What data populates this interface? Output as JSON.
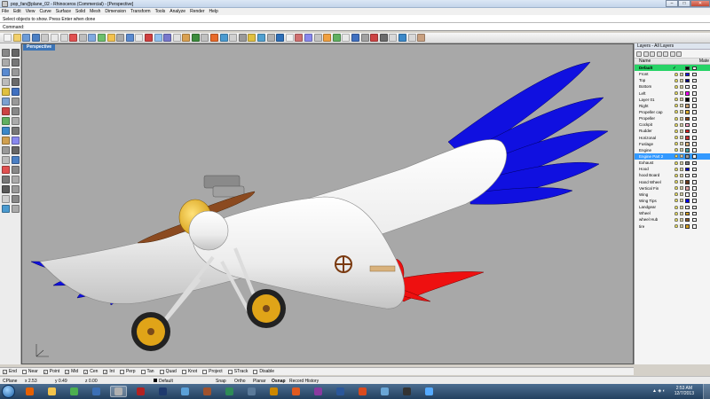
{
  "window": {
    "title": "pop_fan@plane_02 - Rhinoceros (Commercial) - [Perspective]",
    "min_label": "–",
    "max_label": "□",
    "close_label": "✕"
  },
  "menu": [
    "File",
    "Edit",
    "View",
    "Curve",
    "Surface",
    "Solid",
    "Mesh",
    "Dimension",
    "Transform",
    "Tools",
    "Analyze",
    "Render",
    "Help"
  ],
  "command": {
    "history": "Select objects to show. Press Enter when done",
    "label": "Command:",
    "value": ""
  },
  "viewport": {
    "name": "Perspective",
    "axis_x": "x",
    "axis_y": "y",
    "axis_z": "z"
  },
  "layers_panel": {
    "title": "Layers - All Layers",
    "col_name": "Name",
    "col_material": "Mate",
    "layers": [
      {
        "name": "Default",
        "color": "#000000",
        "current": true,
        "selected": false
      },
      {
        "name": "Front",
        "color": "#1a1aff",
        "current": false,
        "selected": false
      },
      {
        "name": "Top",
        "color": "#000080",
        "current": false,
        "selected": false
      },
      {
        "name": "Bottom",
        "color": "#ffffff",
        "current": false,
        "selected": false
      },
      {
        "name": "Left",
        "color": "#ff00ff",
        "current": false,
        "selected": false
      },
      {
        "name": "Layer 01",
        "color": "#000000",
        "current": false,
        "selected": false
      },
      {
        "name": "Right",
        "color": "#c8a070",
        "current": false,
        "selected": false
      },
      {
        "name": "Propeller cap",
        "color": "#e0b030",
        "current": false,
        "selected": false
      },
      {
        "name": "Propeller",
        "color": "#8b4513",
        "current": false,
        "selected": false
      },
      {
        "name": "Cockpit",
        "color": "#ffaacc",
        "current": false,
        "selected": false
      },
      {
        "name": "Rudder",
        "color": "#dd2222",
        "current": false,
        "selected": false
      },
      {
        "name": "Horizonal",
        "color": "#cc3333",
        "current": false,
        "selected": false
      },
      {
        "name": "Fuslage",
        "color": "#d9b27c",
        "current": false,
        "selected": false
      },
      {
        "name": "Engine",
        "color": "#40a0a0",
        "current": false,
        "selected": false
      },
      {
        "name": "Engine Part 2",
        "color": "#9a9a9a",
        "current": false,
        "selected": true
      },
      {
        "name": "Exhaust",
        "color": "#7f7f7f",
        "current": false,
        "selected": false
      },
      {
        "name": "Hood",
        "color": "#0000cc",
        "current": false,
        "selected": false
      },
      {
        "name": "hood Board",
        "color": "#ffffff",
        "current": false,
        "selected": false
      },
      {
        "name": "Hand Wheel",
        "color": "#6b3a1b",
        "current": false,
        "selected": false
      },
      {
        "name": "Vertical Fin",
        "color": "#e0a0a0",
        "current": false,
        "selected": false
      },
      {
        "name": "Wing",
        "color": "#ffffff",
        "current": false,
        "selected": false
      },
      {
        "name": "Wing Tips",
        "color": "#0000ff",
        "current": false,
        "selected": false
      },
      {
        "name": "Landgear",
        "color": "#ffffff",
        "current": false,
        "selected": false
      },
      {
        "name": "Wheel",
        "color": "#d8a020",
        "current": false,
        "selected": false
      },
      {
        "name": "wheel Hub",
        "color": "#8b5a2b",
        "current": false,
        "selected": false
      },
      {
        "name": "tire",
        "color": "#d8a020",
        "current": false,
        "selected": false
      }
    ]
  },
  "osnap": [
    {
      "label": "End",
      "checked": true
    },
    {
      "label": "Near",
      "checked": false
    },
    {
      "label": "Point",
      "checked": true
    },
    {
      "label": "Mid",
      "checked": true
    },
    {
      "label": "Cen",
      "checked": true
    },
    {
      "label": "Int",
      "checked": true
    },
    {
      "label": "Perp",
      "checked": false
    },
    {
      "label": "Tan",
      "checked": false
    },
    {
      "label": "Quad",
      "checked": false
    },
    {
      "label": "Knot",
      "checked": false
    },
    {
      "label": "Project",
      "checked": false
    },
    {
      "label": "STrack",
      "checked": false
    },
    {
      "label": "Disable",
      "checked": false
    }
  ],
  "status": {
    "cplane": "CPlane",
    "x": "x 2.53",
    "y": "y 0.49",
    "z": "z 0.00",
    "layer": "Default",
    "snap": "Snap",
    "ortho": "Ortho",
    "planar": "Planar",
    "osnap": "Osnap",
    "history": "Record History"
  },
  "taskbar": {
    "time": "2:53 AM",
    "date": "12/7/2013",
    "apps": [
      {
        "name": "firefox",
        "color": "#e66000"
      },
      {
        "name": "explorer",
        "color": "#f3c34b"
      },
      {
        "name": "chrome",
        "color": "#4caf50"
      },
      {
        "name": "media",
        "color": "#3b6fb5"
      },
      {
        "name": "rhino",
        "color": "#b0b0b0"
      },
      {
        "name": "app6",
        "color": "#b22222"
      },
      {
        "name": "photoshop",
        "color": "#1e3a6e"
      },
      {
        "name": "app8",
        "color": "#5aa0d8"
      },
      {
        "name": "app9",
        "color": "#a0522d"
      },
      {
        "name": "app10",
        "color": "#2e8b57"
      },
      {
        "name": "app11",
        "color": "#5a7a9a"
      },
      {
        "name": "app12",
        "color": "#cc8800"
      },
      {
        "name": "app13",
        "color": "#e05a20"
      },
      {
        "name": "app14",
        "color": "#8a3aa0"
      },
      {
        "name": "word",
        "color": "#2b579a"
      },
      {
        "name": "app16",
        "color": "#d94a1e"
      },
      {
        "name": "app17",
        "color": "#6aa6d6"
      },
      {
        "name": "app18",
        "color": "#333333"
      },
      {
        "name": "app19",
        "color": "#55aaff"
      }
    ]
  }
}
